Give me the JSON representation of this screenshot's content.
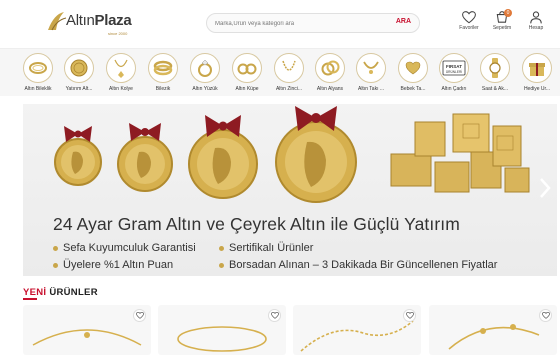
{
  "brand": {
    "name_light": "Altın",
    "name_bold": "Plaza",
    "tagline": "since 2000"
  },
  "search": {
    "placeholder": "Marka,Ürün veya kategori ara",
    "button_label": "ARA"
  },
  "header_actions": [
    {
      "label": "Favoriler",
      "icon": "heart-icon"
    },
    {
      "label": "Sepetim",
      "icon": "cart-icon",
      "badge": "0"
    },
    {
      "label": "Hesap",
      "icon": "user-icon"
    }
  ],
  "categories": [
    {
      "label": "Altın Bileklik",
      "icon": "bracelet-icon"
    },
    {
      "label": "Yatırım Alt...",
      "icon": "coin-icon"
    },
    {
      "label": "Altın Kolye",
      "icon": "necklace-icon"
    },
    {
      "label": "Bilezik",
      "icon": "bangle-icon"
    },
    {
      "label": "Altın Yüzük",
      "icon": "ring-icon"
    },
    {
      "label": "Altın Küpe",
      "icon": "earring-icon"
    },
    {
      "label": "Altın Zinci...",
      "icon": "chain-icon"
    },
    {
      "label": "Altın Alyans",
      "icon": "wedding-band-icon"
    },
    {
      "label": "Altın Takı ...",
      "icon": "jewelry-set-icon"
    },
    {
      "label": "Bebek Ta...",
      "icon": "baby-jewelry-icon"
    },
    {
      "label": "Altın Çadırı",
      "icon": "firsat-tag-icon",
      "tag_line1": "FIRSAT",
      "tag_line2": "ÜRÜNLERİ"
    },
    {
      "label": "Saat & Ak...",
      "icon": "watch-icon"
    },
    {
      "label": "Hediye Ür...",
      "icon": "gift-icon"
    }
  ],
  "banner": {
    "headline": "24 Ayar Gram Altın ve Çeyrek Altın ile Güçlü Yatırım",
    "features": [
      "Sefa Kuyumculuk Garantisi",
      "Sertifikalı Ürünler",
      "Üyelere %1 Altın Puan",
      "Borsadan Alınan – 3 Dakikada Bir Güncellenen Fiyatlar"
    ]
  },
  "new_products": {
    "title_accent": "YENİ",
    "title_rest": " ÜRÜNLER"
  },
  "colors": {
    "accent": "#c8102e",
    "gold": "#c9a64a",
    "ribbon": "#8e1b22"
  }
}
